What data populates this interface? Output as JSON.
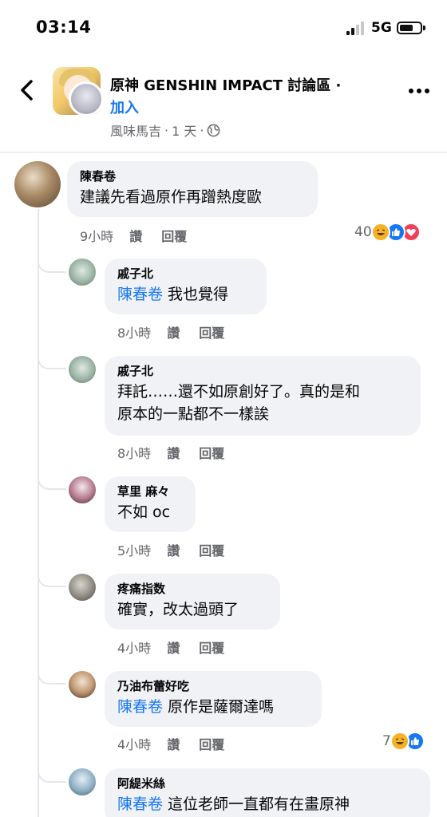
{
  "status_bar": {
    "time": "03:14",
    "network": "5G"
  },
  "header": {
    "group_name": "原神 GENSHIN IMPACT 討論區 ·",
    "join_label": "加入",
    "poster": "風味馬吉",
    "time": "1 天",
    "separator": "·"
  },
  "comments": [
    {
      "author": "陳春卷",
      "mention": "",
      "lines": [
        "建議先看過原作再蹭熱度歐"
      ],
      "time": "9小時",
      "like_label": "讚",
      "reply_label": "回覆",
      "reaction_count": "40",
      "reactions": [
        "haha",
        "like",
        "love"
      ]
    },
    {
      "author": "戚子北",
      "mention": "陳春卷",
      "lines": [
        "我也覺得"
      ],
      "time": "8小時",
      "like_label": "讚",
      "reply_label": "回覆"
    },
    {
      "author": "戚子北",
      "mention": "",
      "lines": [
        "拜託……還不如原創好了。真的是和",
        "原本的一點都不一樣誒"
      ],
      "time": "8小時",
      "like_label": "讚",
      "reply_label": "回覆"
    },
    {
      "author": "草里 麻々",
      "mention": "",
      "lines": [
        "不如 oc"
      ],
      "time": "5小時",
      "like_label": "讚",
      "reply_label": "回覆"
    },
    {
      "author": "疼痛指数",
      "mention": "",
      "lines": [
        "確實，改太過頭了"
      ],
      "time": "4小時",
      "like_label": "讚",
      "reply_label": "回覆"
    },
    {
      "author": "乃油布蕾好吃",
      "mention": "陳春卷",
      "lines": [
        "原作是薩爾達嗎"
      ],
      "time": "4小時",
      "like_label": "讚",
      "reply_label": "回覆",
      "reaction_count": "7",
      "reactions": [
        "haha",
        "like"
      ]
    },
    {
      "author": "阿緹米絲",
      "mention": "陳春卷",
      "lines": [
        "這位老師一直都有在畫原神"
      ]
    }
  ],
  "colors": {
    "link": "#1877f2",
    "bubble": "#f0f2f5",
    "meta": "#65676b",
    "haha": "#f7b125",
    "like": "#1877f2",
    "love": "#f33e58"
  }
}
